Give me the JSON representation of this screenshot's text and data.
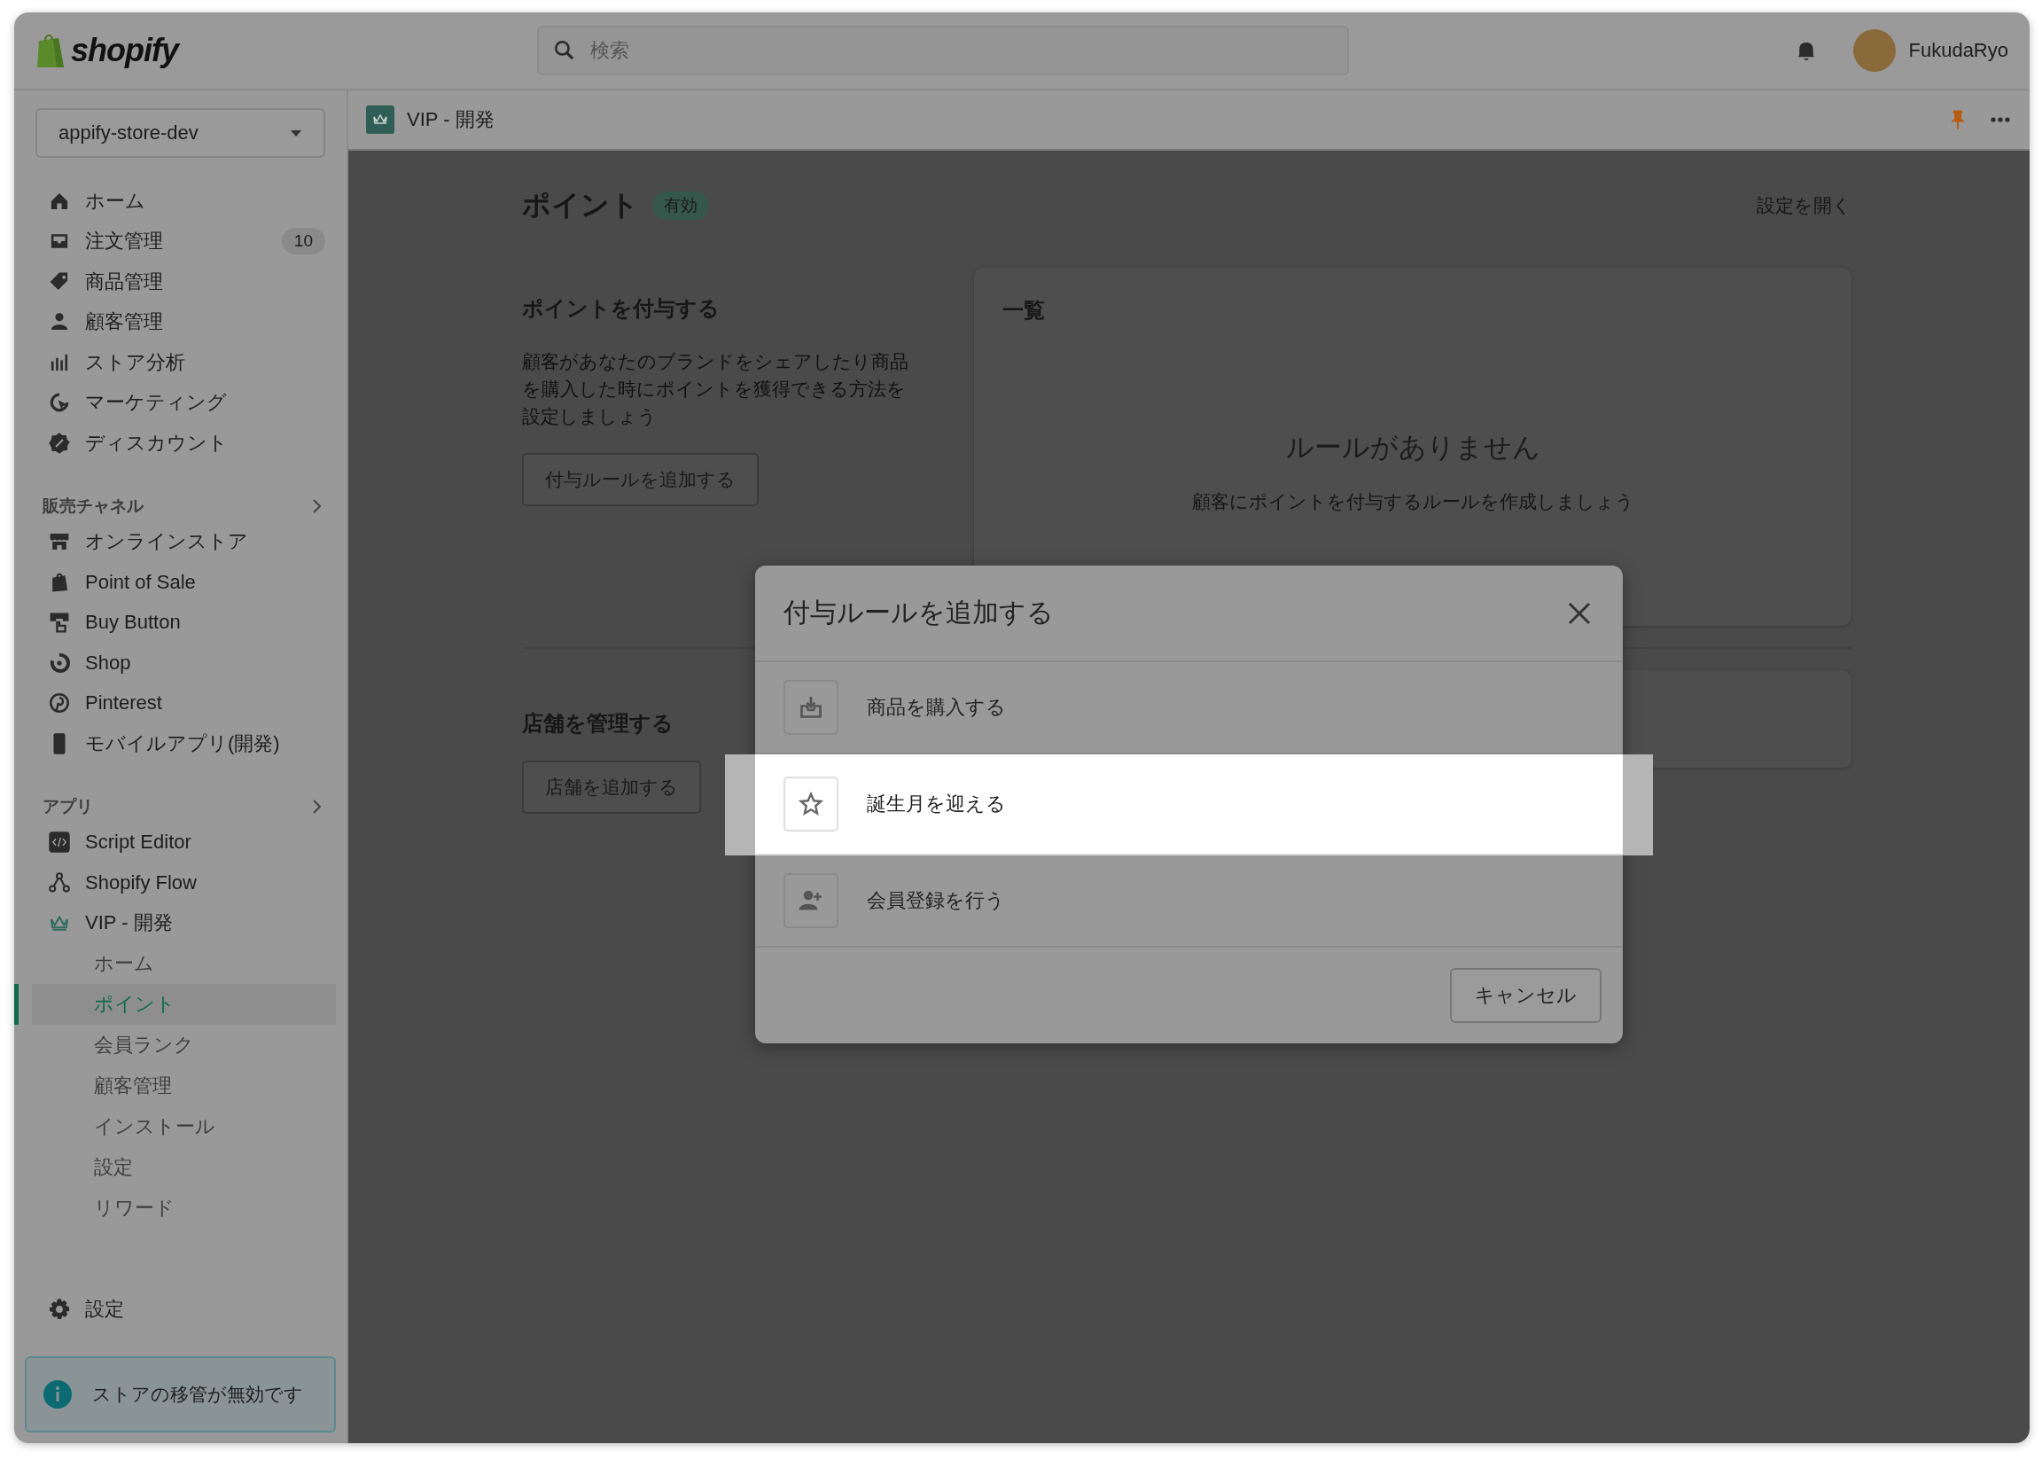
{
  "topbar": {
    "brand": "shopify",
    "search": {
      "placeholder": "検索"
    },
    "user": {
      "name": "FukudaRyo"
    }
  },
  "sidebar": {
    "store": "appify-store-dev",
    "nav": [
      {
        "label": "ホーム",
        "kind": "home"
      },
      {
        "label": "注文管理",
        "kind": "inbox",
        "badge": "10"
      },
      {
        "label": "商品管理",
        "kind": "tag"
      },
      {
        "label": "顧客管理",
        "kind": "person"
      },
      {
        "label": "ストア分析",
        "kind": "bars"
      },
      {
        "label": "マーケティング",
        "kind": "target"
      },
      {
        "label": "ディスカウント",
        "kind": "discount"
      }
    ],
    "sections": [
      {
        "title": "販売チャネル",
        "items": [
          {
            "label": "オンラインストア",
            "kind": "store"
          },
          {
            "label": "Point of Sale",
            "kind": "bag"
          },
          {
            "label": "Buy Button",
            "kind": "cursor"
          },
          {
            "label": "Shop",
            "kind": "shop"
          },
          {
            "label": "Pinterest",
            "kind": "pin"
          },
          {
            "label": "モバイルアプリ(開発)",
            "kind": "phone"
          }
        ]
      },
      {
        "title": "アプリ",
        "items": [
          {
            "label": "Script Editor",
            "kind": "code"
          },
          {
            "label": "Shopify Flow",
            "kind": "flow"
          },
          {
            "label": "VIP - 開発",
            "kind": "crown",
            "children": [
              {
                "label": "ホーム",
                "selected": false
              },
              {
                "label": "ポイント",
                "selected": true
              },
              {
                "label": "会員ランク",
                "selected": false
              },
              {
                "label": "顧客管理",
                "selected": false
              },
              {
                "label": "インストール",
                "selected": false
              },
              {
                "label": "設定",
                "selected": false
              },
              {
                "label": "リワード",
                "selected": false
              }
            ]
          }
        ]
      }
    ],
    "settings": {
      "label": "設定"
    },
    "notice": "ストアの移管が無効です"
  },
  "breadcrumb": {
    "title": "VIP - 開発"
  },
  "page": {
    "title": "ポイント",
    "status": "有効",
    "action": "設定を開く",
    "earn": {
      "heading": "ポイントを付与する",
      "description": "顧客があなたのブランドをシェアしたり商品を購入した時にポイントを獲得できる方法を設定しましょう",
      "button": "付与ルールを追加する"
    },
    "list": {
      "heading": "一覧",
      "empty_title": "ルールがありません",
      "empty_text": "顧客にポイントを付与するルールを作成しましょう"
    },
    "stores": {
      "heading": "店舗を管理する",
      "button": "店舗を追加する"
    }
  },
  "modal": {
    "title": "付与ルールを追加する",
    "options": [
      {
        "label": "商品を購入する",
        "kind": "download",
        "highlighted": false
      },
      {
        "label": "誕生月を迎える",
        "kind": "star",
        "highlighted": true
      },
      {
        "label": "会員登録を行う",
        "kind": "person-add",
        "highlighted": false
      }
    ],
    "cancel": "キャンセル"
  }
}
